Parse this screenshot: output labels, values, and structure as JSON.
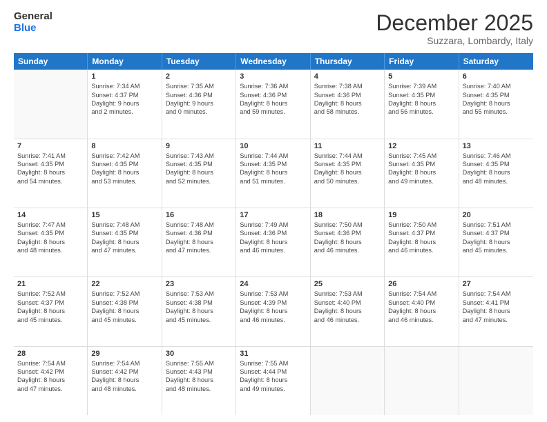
{
  "header": {
    "logo_line1": "General",
    "logo_line2": "Blue",
    "month": "December 2025",
    "location": "Suzzara, Lombardy, Italy"
  },
  "weekdays": [
    "Sunday",
    "Monday",
    "Tuesday",
    "Wednesday",
    "Thursday",
    "Friday",
    "Saturday"
  ],
  "rows": [
    [
      {
        "day": "",
        "lines": []
      },
      {
        "day": "1",
        "lines": [
          "Sunrise: 7:34 AM",
          "Sunset: 4:37 PM",
          "Daylight: 9 hours",
          "and 2 minutes."
        ]
      },
      {
        "day": "2",
        "lines": [
          "Sunrise: 7:35 AM",
          "Sunset: 4:36 PM",
          "Daylight: 9 hours",
          "and 0 minutes."
        ]
      },
      {
        "day": "3",
        "lines": [
          "Sunrise: 7:36 AM",
          "Sunset: 4:36 PM",
          "Daylight: 8 hours",
          "and 59 minutes."
        ]
      },
      {
        "day": "4",
        "lines": [
          "Sunrise: 7:38 AM",
          "Sunset: 4:36 PM",
          "Daylight: 8 hours",
          "and 58 minutes."
        ]
      },
      {
        "day": "5",
        "lines": [
          "Sunrise: 7:39 AM",
          "Sunset: 4:35 PM",
          "Daylight: 8 hours",
          "and 56 minutes."
        ]
      },
      {
        "day": "6",
        "lines": [
          "Sunrise: 7:40 AM",
          "Sunset: 4:35 PM",
          "Daylight: 8 hours",
          "and 55 minutes."
        ]
      }
    ],
    [
      {
        "day": "7",
        "lines": [
          "Sunrise: 7:41 AM",
          "Sunset: 4:35 PM",
          "Daylight: 8 hours",
          "and 54 minutes."
        ]
      },
      {
        "day": "8",
        "lines": [
          "Sunrise: 7:42 AM",
          "Sunset: 4:35 PM",
          "Daylight: 8 hours",
          "and 53 minutes."
        ]
      },
      {
        "day": "9",
        "lines": [
          "Sunrise: 7:43 AM",
          "Sunset: 4:35 PM",
          "Daylight: 8 hours",
          "and 52 minutes."
        ]
      },
      {
        "day": "10",
        "lines": [
          "Sunrise: 7:44 AM",
          "Sunset: 4:35 PM",
          "Daylight: 8 hours",
          "and 51 minutes."
        ]
      },
      {
        "day": "11",
        "lines": [
          "Sunrise: 7:44 AM",
          "Sunset: 4:35 PM",
          "Daylight: 8 hours",
          "and 50 minutes."
        ]
      },
      {
        "day": "12",
        "lines": [
          "Sunrise: 7:45 AM",
          "Sunset: 4:35 PM",
          "Daylight: 8 hours",
          "and 49 minutes."
        ]
      },
      {
        "day": "13",
        "lines": [
          "Sunrise: 7:46 AM",
          "Sunset: 4:35 PM",
          "Daylight: 8 hours",
          "and 48 minutes."
        ]
      }
    ],
    [
      {
        "day": "14",
        "lines": [
          "Sunrise: 7:47 AM",
          "Sunset: 4:35 PM",
          "Daylight: 8 hours",
          "and 48 minutes."
        ]
      },
      {
        "day": "15",
        "lines": [
          "Sunrise: 7:48 AM",
          "Sunset: 4:35 PM",
          "Daylight: 8 hours",
          "and 47 minutes."
        ]
      },
      {
        "day": "16",
        "lines": [
          "Sunrise: 7:48 AM",
          "Sunset: 4:36 PM",
          "Daylight: 8 hours",
          "and 47 minutes."
        ]
      },
      {
        "day": "17",
        "lines": [
          "Sunrise: 7:49 AM",
          "Sunset: 4:36 PM",
          "Daylight: 8 hours",
          "and 46 minutes."
        ]
      },
      {
        "day": "18",
        "lines": [
          "Sunrise: 7:50 AM",
          "Sunset: 4:36 PM",
          "Daylight: 8 hours",
          "and 46 minutes."
        ]
      },
      {
        "day": "19",
        "lines": [
          "Sunrise: 7:50 AM",
          "Sunset: 4:37 PM",
          "Daylight: 8 hours",
          "and 46 minutes."
        ]
      },
      {
        "day": "20",
        "lines": [
          "Sunrise: 7:51 AM",
          "Sunset: 4:37 PM",
          "Daylight: 8 hours",
          "and 45 minutes."
        ]
      }
    ],
    [
      {
        "day": "21",
        "lines": [
          "Sunrise: 7:52 AM",
          "Sunset: 4:37 PM",
          "Daylight: 8 hours",
          "and 45 minutes."
        ]
      },
      {
        "day": "22",
        "lines": [
          "Sunrise: 7:52 AM",
          "Sunset: 4:38 PM",
          "Daylight: 8 hours",
          "and 45 minutes."
        ]
      },
      {
        "day": "23",
        "lines": [
          "Sunrise: 7:53 AM",
          "Sunset: 4:38 PM",
          "Daylight: 8 hours",
          "and 45 minutes."
        ]
      },
      {
        "day": "24",
        "lines": [
          "Sunrise: 7:53 AM",
          "Sunset: 4:39 PM",
          "Daylight: 8 hours",
          "and 46 minutes."
        ]
      },
      {
        "day": "25",
        "lines": [
          "Sunrise: 7:53 AM",
          "Sunset: 4:40 PM",
          "Daylight: 8 hours",
          "and 46 minutes."
        ]
      },
      {
        "day": "26",
        "lines": [
          "Sunrise: 7:54 AM",
          "Sunset: 4:40 PM",
          "Daylight: 8 hours",
          "and 46 minutes."
        ]
      },
      {
        "day": "27",
        "lines": [
          "Sunrise: 7:54 AM",
          "Sunset: 4:41 PM",
          "Daylight: 8 hours",
          "and 47 minutes."
        ]
      }
    ],
    [
      {
        "day": "28",
        "lines": [
          "Sunrise: 7:54 AM",
          "Sunset: 4:42 PM",
          "Daylight: 8 hours",
          "and 47 minutes."
        ]
      },
      {
        "day": "29",
        "lines": [
          "Sunrise: 7:54 AM",
          "Sunset: 4:42 PM",
          "Daylight: 8 hours",
          "and 48 minutes."
        ]
      },
      {
        "day": "30",
        "lines": [
          "Sunrise: 7:55 AM",
          "Sunset: 4:43 PM",
          "Daylight: 8 hours",
          "and 48 minutes."
        ]
      },
      {
        "day": "31",
        "lines": [
          "Sunrise: 7:55 AM",
          "Sunset: 4:44 PM",
          "Daylight: 8 hours",
          "and 49 minutes."
        ]
      },
      {
        "day": "",
        "lines": []
      },
      {
        "day": "",
        "lines": []
      },
      {
        "day": "",
        "lines": []
      }
    ]
  ]
}
